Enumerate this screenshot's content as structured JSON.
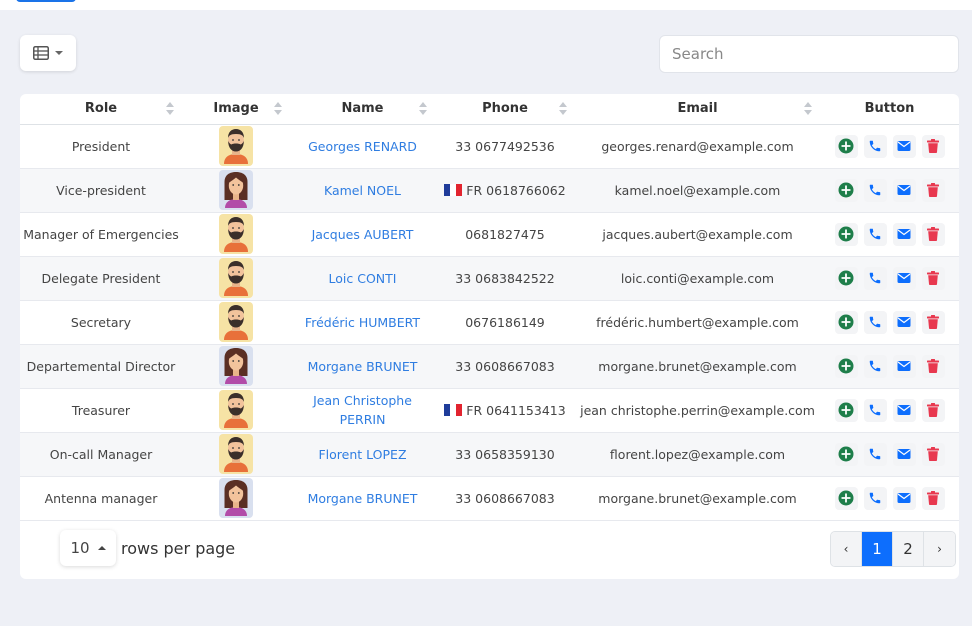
{
  "toolbar": {
    "search_placeholder": "Search",
    "view_icon": "table-list-icon"
  },
  "table": {
    "headers": [
      "Role",
      "Image",
      "Name",
      "Phone",
      "Email",
      "Button"
    ],
    "rows": [
      {
        "role": "President",
        "avatar": "man",
        "name": "Georges RENARD",
        "phone_flag": false,
        "phone": "33 0677492536",
        "email": "georges.renard@example.com"
      },
      {
        "role": "Vice-president",
        "avatar": "woman",
        "name": "Kamel NOEL",
        "phone_flag": true,
        "phone_prefix": "FR",
        "phone": "0618766062",
        "email": "kamel.noel@example.com"
      },
      {
        "role": "Manager of Emergencies",
        "avatar": "man",
        "name": "Jacques AUBERT",
        "phone_flag": false,
        "phone": "0681827475",
        "email": "jacques.aubert@example.com"
      },
      {
        "role": "Delegate President",
        "avatar": "man",
        "name": "Loic CONTI",
        "phone_flag": false,
        "phone": "33 0683842522",
        "email": "loic.conti@example.com"
      },
      {
        "role": "Secretary",
        "avatar": "man",
        "name": "Frédéric HUMBERT",
        "phone_flag": false,
        "phone": "0676186149",
        "email": "frédéric.humbert@example.com"
      },
      {
        "role": "Departemental Director",
        "avatar": "woman",
        "name": "Morgane BRUNET",
        "phone_flag": false,
        "phone": "33 0608667083",
        "email": "morgane.brunet@example.com"
      },
      {
        "role": "Treasurer",
        "avatar": "man",
        "name": "Jean Christophe PERRIN",
        "phone_flag": true,
        "phone_prefix": "FR",
        "phone": "0641153413",
        "email": "jean christophe.perrin@example.com"
      },
      {
        "role": "On-call Manager",
        "avatar": "man",
        "name": "Florent LOPEZ",
        "phone_flag": false,
        "phone": "33 0658359130",
        "email": "florent.lopez@example.com"
      },
      {
        "role": "Antenna manager",
        "avatar": "woman",
        "name": "Morgane BRUNET",
        "phone_flag": false,
        "phone": "33 0608667083",
        "email": "morgane.brunet@example.com"
      }
    ],
    "row_buttons": [
      "plus-circle-icon",
      "phone-icon",
      "envelope-icon",
      "trash-icon"
    ]
  },
  "footer": {
    "rows_per_page_value": "10",
    "rows_per_page_label": "rows per page",
    "pages": [
      "1",
      "2"
    ],
    "prev_label": "‹",
    "next_label": "›",
    "active_page": "1"
  },
  "colors": {
    "accent": "#0d6efd",
    "link": "#2f7de1",
    "add": "#1e7e4a",
    "delete": "#e8384f"
  }
}
